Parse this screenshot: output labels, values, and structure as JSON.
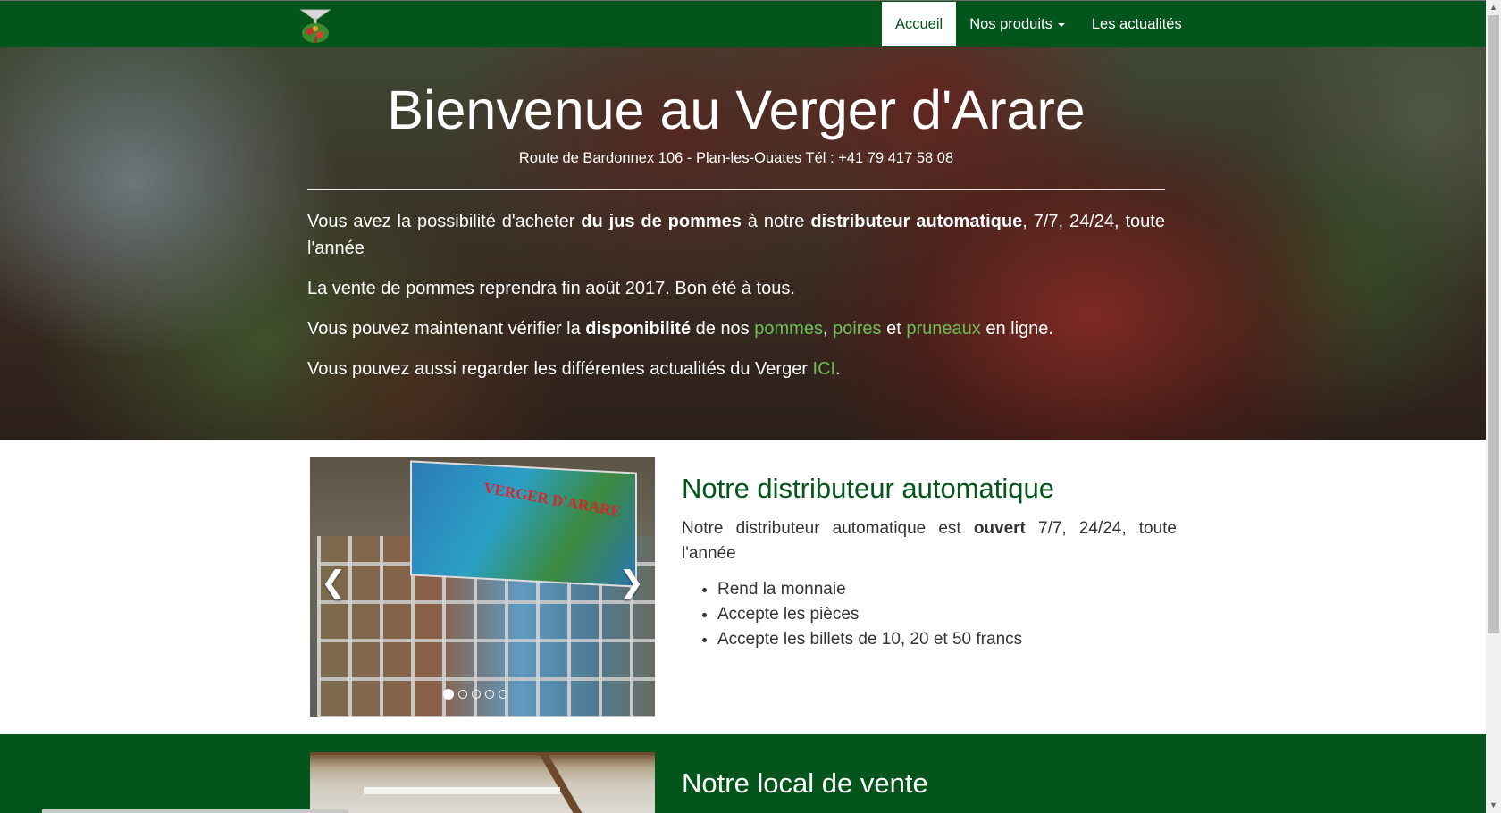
{
  "nav": {
    "logo_icon": "orchard-logo-icon",
    "items": [
      {
        "label": "Accueil",
        "active": true
      },
      {
        "label": "Nos produits",
        "dropdown": true
      },
      {
        "label": "Les actualités"
      }
    ]
  },
  "hero": {
    "title": "Bienvenue au Verger d'Arare",
    "subtitle": "Route de Bardonnex 106 - Plan-les-Ouates Tél : +41 79 417 58 08",
    "p1": {
      "t1": "Vous avez la possibilité d'acheter ",
      "b1": "du jus de pommes",
      "t2": " à notre ",
      "b2": "distributeur automatique",
      "t3": ", 7/7, 24/24, toute l'année"
    },
    "p2": "La vente de pommes reprendra fin août 2017. Bon été à tous.",
    "p3": {
      "t1": "Vous pouvez maintenant vérifier la ",
      "b1": "disponibilité",
      "t2": " de nos ",
      "link1": "pommes",
      "t3": ", ",
      "link2": "poires",
      "t4": " et ",
      "link3": "pruneaux",
      "t5": " en ligne."
    },
    "p4": {
      "t1": "Vous pouvez aussi regarder les différentes actualités du Verger ",
      "link": "ICI",
      "t2": "."
    }
  },
  "distributor": {
    "title": "Notre distributeur automatique",
    "desc_t1": "Notre distributeur automatique est ",
    "desc_b": "ouvert",
    "desc_t2": " 7/7, 24/24, toute l'année",
    "features": [
      "Rend la monnaie",
      "Accepte les pièces",
      "Accepte les billets de 10, 20 et 50 francs"
    ],
    "carousel": {
      "banner_text": "VERGER D'ARARE",
      "prev_icon": "chevron-left-icon",
      "next_icon": "chevron-right-icon",
      "slide_count": 5,
      "active_slide": 1
    }
  },
  "local": {
    "title": "Notre local de vente"
  },
  "colors": {
    "brand_green": "#04551b",
    "link_green": "#6fbf59"
  }
}
